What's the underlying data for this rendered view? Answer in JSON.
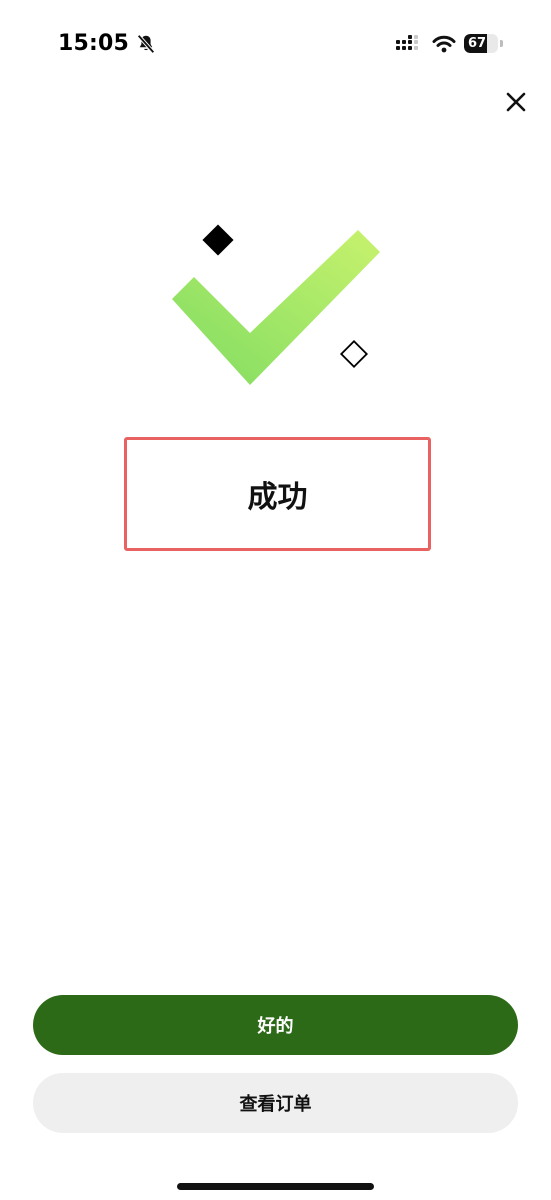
{
  "status_bar": {
    "time": "15:05",
    "battery_percent": "67",
    "battery_level": 0.67,
    "icons": [
      "bell-off-icon",
      "cellular-signal-icon",
      "wifi-icon",
      "battery-icon"
    ]
  },
  "close_icon": "close-icon",
  "hero": {
    "icon": "checkmark-icon",
    "gradient_start": "#7fdc62",
    "gradient_end": "#c8f26d"
  },
  "result": {
    "title": "成功",
    "highlight_color": "#e86262"
  },
  "actions": {
    "primary_label": "好的",
    "primary_color": "#2d6a18",
    "secondary_label": "查看订单",
    "secondary_color": "#efefef"
  }
}
